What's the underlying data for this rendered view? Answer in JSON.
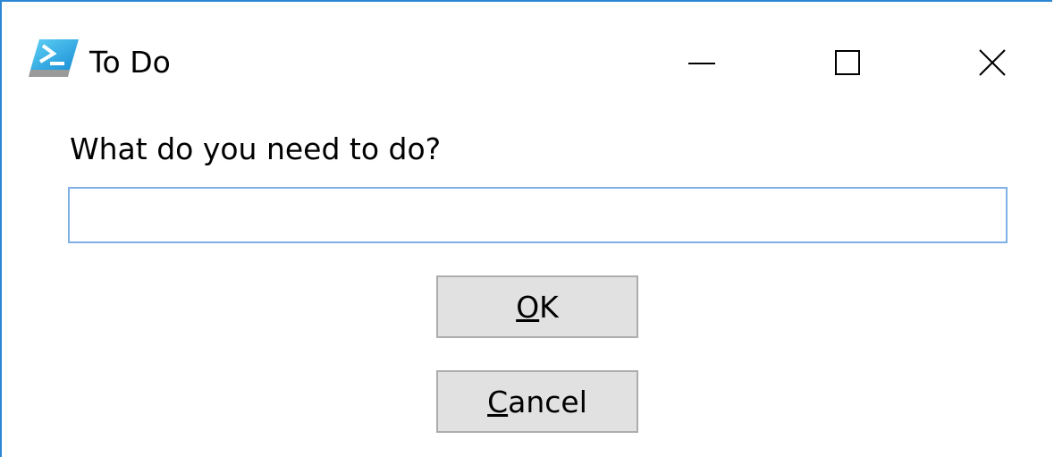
{
  "window": {
    "title": "To Do",
    "icon": "powershell-icon",
    "accent_color": "#2b87d3"
  },
  "caption_buttons": {
    "minimize_icon": "minimize-icon",
    "maximize_icon": "maximize-icon",
    "close_icon": "close-icon"
  },
  "dialog": {
    "prompt": "What do you need to do?",
    "input_value": "",
    "ok_button": {
      "mnemonic": "O",
      "rest": "K"
    },
    "cancel_button": {
      "mnemonic": "C",
      "rest": "ancel"
    }
  }
}
